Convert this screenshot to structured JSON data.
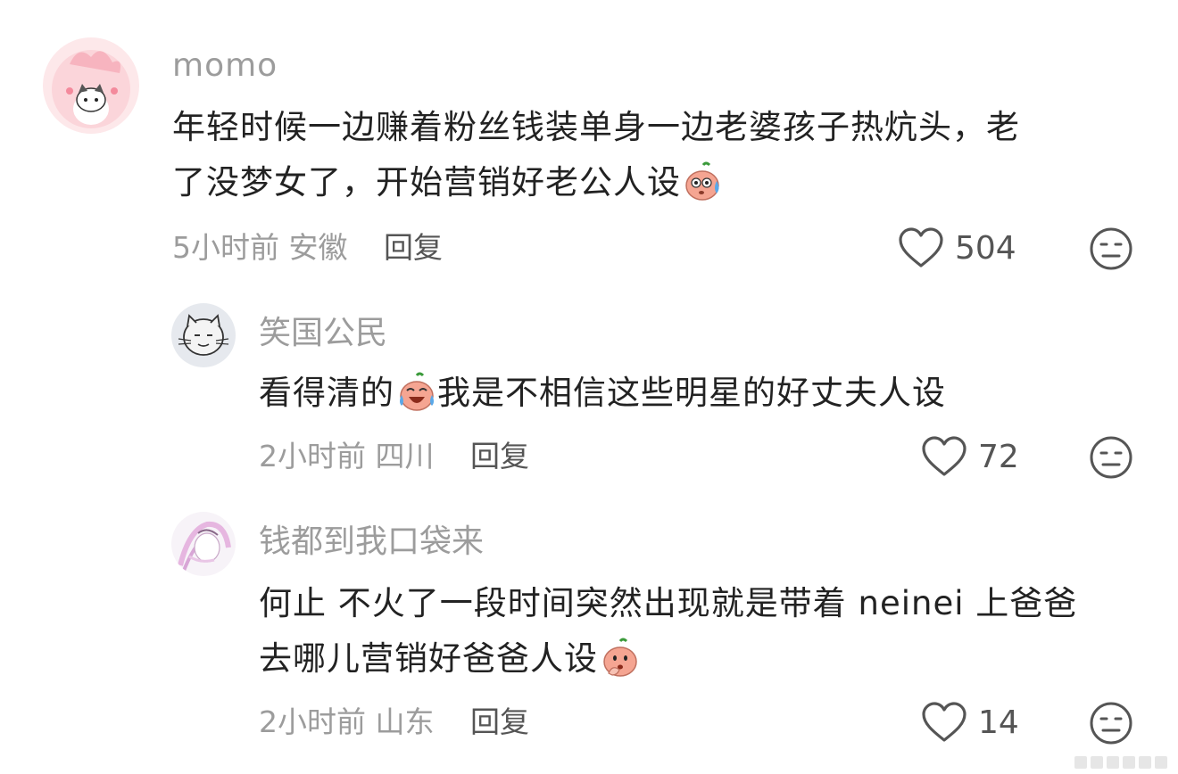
{
  "comments": [
    {
      "username": "momo",
      "lines": [
        "年轻时候一边赚着粉丝钱装单身一边老婆孩子热炕头，老",
        "了没梦女了，开始营销好老公人设"
      ],
      "emoji": "sweat-peach-icon",
      "time": "5小时前",
      "location": "安徽",
      "reply_label": "回复",
      "likes": "504"
    },
    {
      "username": "笑国公民",
      "line_prefix": "看得清的",
      "line_suffix": "我是不相信这些明星的好丈夫人设",
      "emoji": "laugh-cry-peach-icon",
      "time": "2小时前",
      "location": "四川",
      "reply_label": "回复",
      "likes": "72"
    },
    {
      "username": "钱都到我口袋来",
      "lines": [
        "何止 不火了一段时间突然出现就是带着 neinei 上爸爸",
        "去哪儿营销好爸爸人设"
      ],
      "emoji": "thinking-peach-icon",
      "time": "2小时前",
      "location": "山东",
      "reply_label": "回复",
      "likes": "14"
    }
  ],
  "colors": {
    "username": "#9c9c9c",
    "text": "#222222",
    "meta": "#9c9c9c",
    "reply": "#555555",
    "icon": "#555555",
    "peach": "#f2a08f"
  }
}
